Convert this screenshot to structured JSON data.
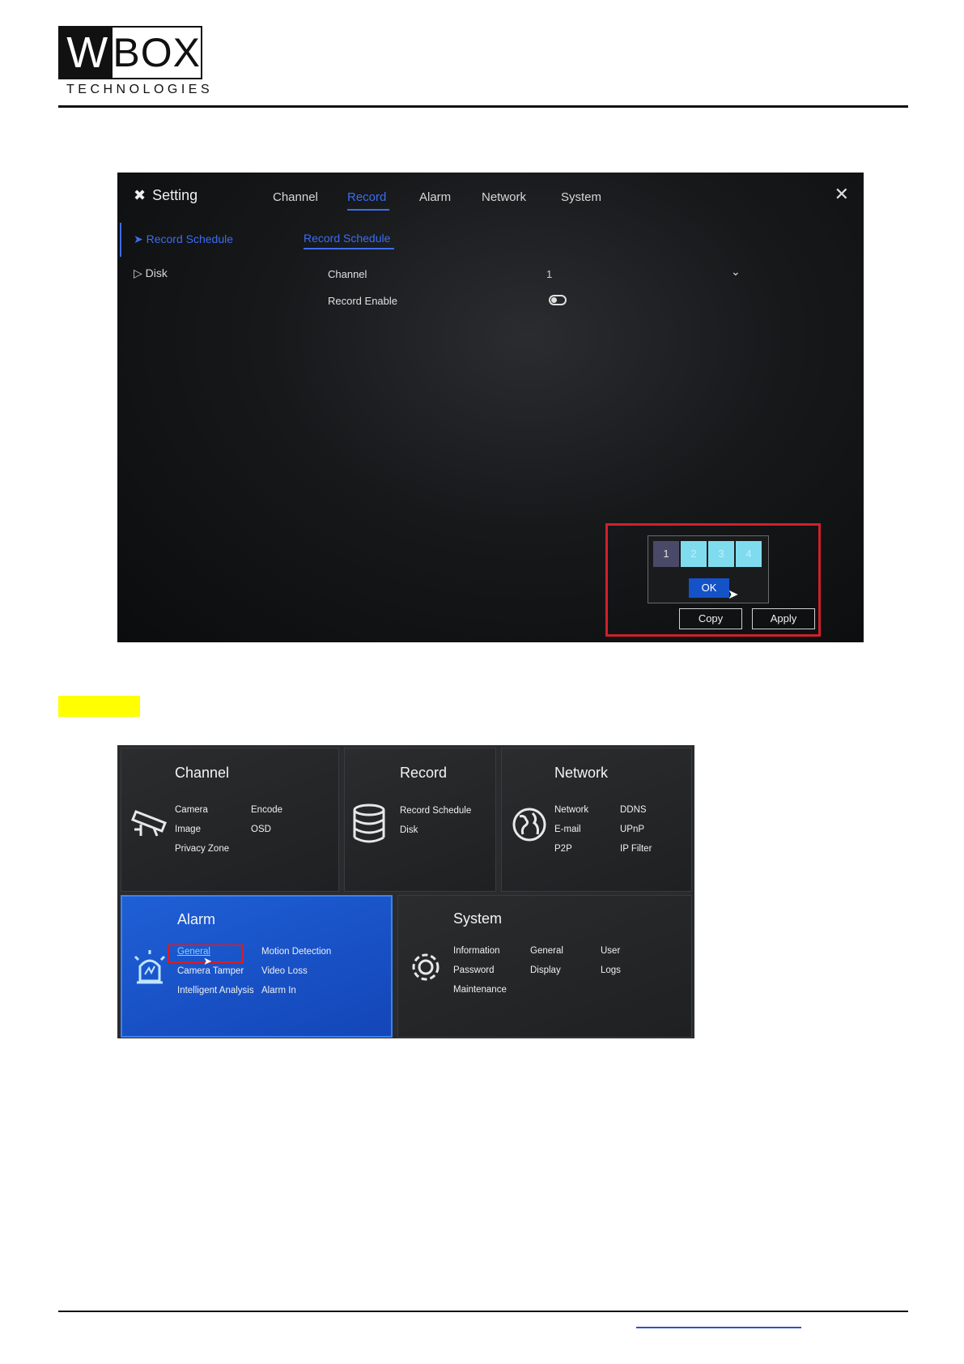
{
  "brand": {
    "logo_letter": "W",
    "logo_word": "BOX",
    "logo_sub": "TECHNOLOGIES"
  },
  "settings_screen": {
    "title": "Setting",
    "tabs": [
      {
        "label": "Channel",
        "active": false
      },
      {
        "label": "Record",
        "active": true
      },
      {
        "label": "Alarm",
        "active": false
      },
      {
        "label": "Network",
        "active": false
      },
      {
        "label": "System",
        "active": false
      }
    ],
    "sidebar": [
      {
        "label": "➤ Record Schedule",
        "active": true
      },
      {
        "label": "▷ Disk",
        "active": false
      }
    ],
    "subtab": "Record Schedule",
    "fields": {
      "channel_label": "Channel",
      "channel_value": "1",
      "record_enable_label": "Record Enable",
      "record_enable_on": false
    },
    "copy_popup": {
      "channels": [
        "1",
        "2",
        "3",
        "4"
      ],
      "selected": "1",
      "ok_label": "OK"
    },
    "buttons": {
      "copy": "Copy",
      "apply": "Apply"
    },
    "colors": {
      "accent": "#3d6cf0",
      "highlight": "#d0202a"
    }
  },
  "main_menu": {
    "channel": {
      "title": "Channel",
      "icon": "camera-icon",
      "items": [
        "Camera",
        "Encode",
        "Image",
        "OSD",
        "Privacy Zone"
      ]
    },
    "record": {
      "title": "Record",
      "icon": "disk-stack-icon",
      "items": [
        "Record Schedule",
        "Disk"
      ]
    },
    "network": {
      "title": "Network",
      "icon": "globe-icon",
      "items": [
        "Network",
        "DDNS",
        "E-mail",
        "UPnP",
        "P2P",
        "IP Filter"
      ]
    },
    "alarm": {
      "title": "Alarm",
      "icon": "siren-icon",
      "items": [
        "General",
        "Motion Detection",
        "Camera Tamper",
        "Video Loss",
        "Intelligent Analysis",
        "Alarm In"
      ],
      "selected_item": "General"
    },
    "system": {
      "title": "System",
      "icon": "gear-icon",
      "items": [
        "Information",
        "General",
        "User",
        "Password",
        "Display",
        "Logs",
        "Maintenance"
      ]
    }
  }
}
